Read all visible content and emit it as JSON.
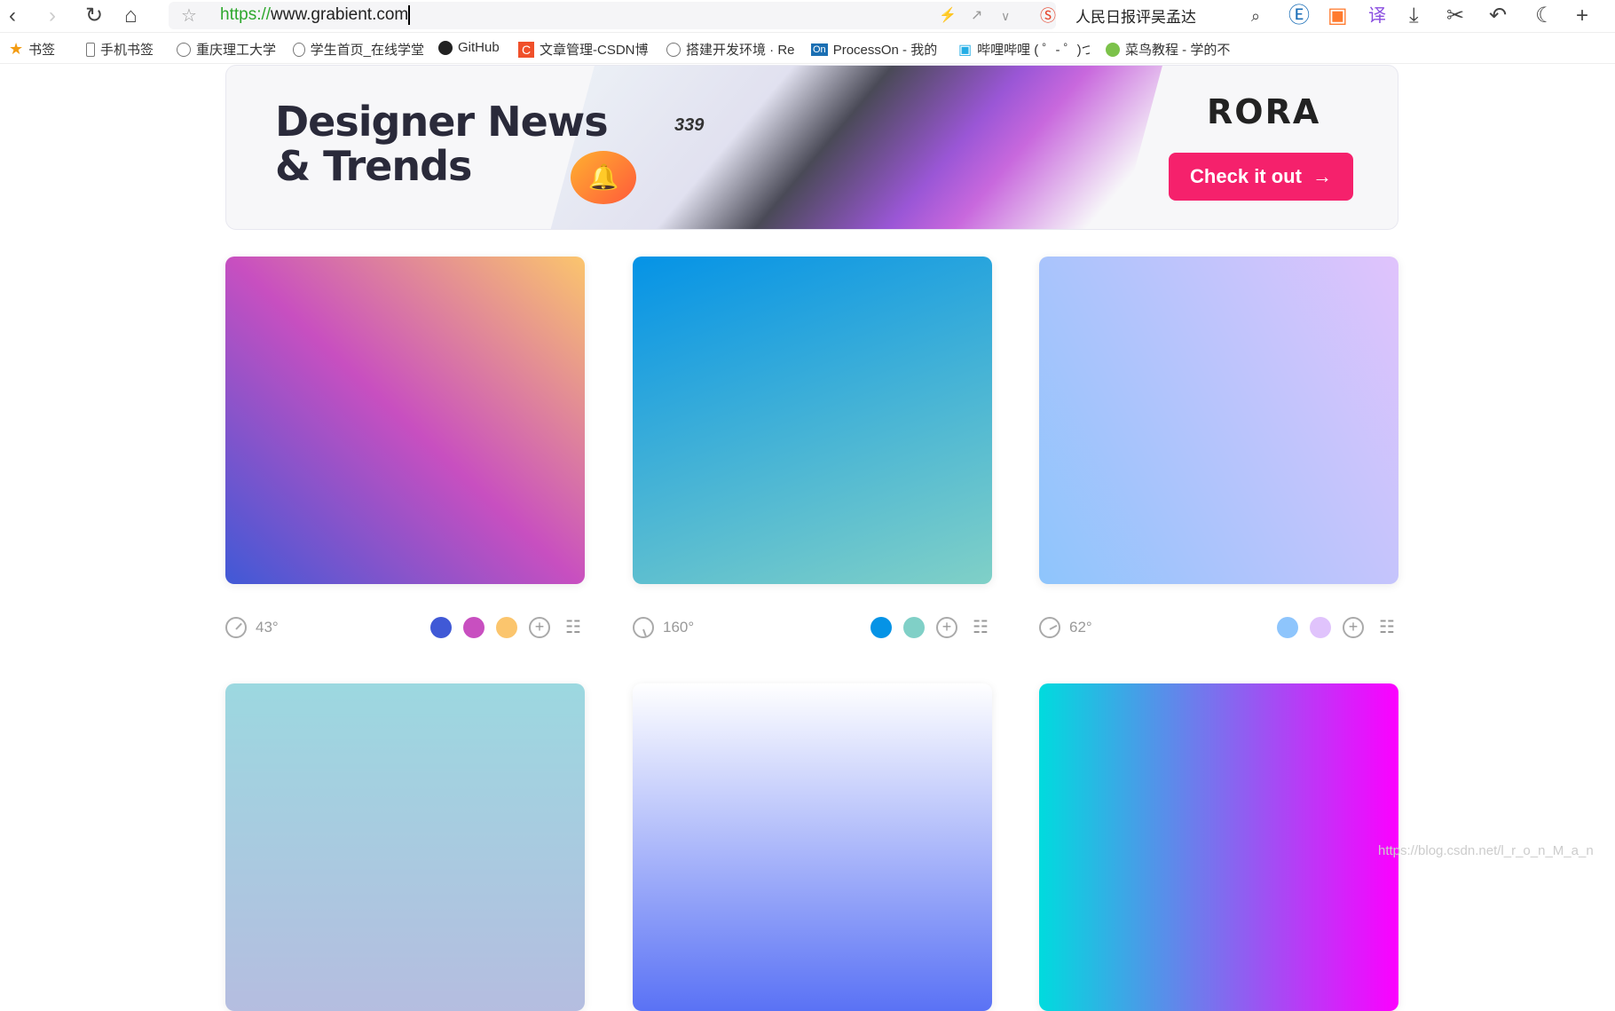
{
  "browser": {
    "url_protocol": "https://",
    "url_host": "www.grabient.com",
    "search_text": "人民日报评吴孟达"
  },
  "bookmarks": [
    {
      "label": "书签",
      "icon": "star-icon"
    },
    {
      "label": "手机书签",
      "icon": "phone-icon"
    },
    {
      "label": "重庆理工大学",
      "icon": "globe-icon"
    },
    {
      "label": "学生首页_在线学堂",
      "icon": "globe-icon"
    },
    {
      "label": "GitHub",
      "icon": "github-icon"
    },
    {
      "label": "文章管理-CSDN博",
      "icon": "csdn-icon"
    },
    {
      "label": "搭建开发环境 · Re",
      "icon": "globe-icon"
    },
    {
      "label": "ProcessOn - 我的",
      "icon": "processon-icon"
    },
    {
      "label": "哔哩哔哩 ( ゜- ゜)つ",
      "icon": "bilibili-icon"
    },
    {
      "label": "菜鸟教程 - 学的不",
      "icon": "runoob-icon"
    }
  ],
  "banner": {
    "title_line1": "Designer News",
    "title_line2": "& Trends",
    "logo": "RORA",
    "art_number": "339",
    "cta_label": "Check it out",
    "cta_color": "#f5216c"
  },
  "gradients": [
    {
      "angle": "43°",
      "angle_deg": 43,
      "colors": [
        "#4059d6",
        "#c84fc0",
        "#fbc56d"
      ]
    },
    {
      "angle": "160°",
      "angle_deg": 160,
      "colors": [
        "#0593e6",
        "#80d0c7"
      ]
    },
    {
      "angle": "62°",
      "angle_deg": 62,
      "colors": [
        "#8ec5fc",
        "#e0c3fc"
      ]
    },
    {
      "angle_deg": 180,
      "colors": [
        "#9cd8e0",
        "#b5bde0"
      ]
    },
    {
      "angle_deg": 180,
      "colors": [
        "#ffffff",
        "#5a72f5"
      ]
    },
    {
      "angle_deg": 90,
      "colors": [
        "#00dbde",
        "#fc00ff"
      ]
    }
  ],
  "watermark": "https://blog.csdn.net/l_r_o_n_M_a_n"
}
